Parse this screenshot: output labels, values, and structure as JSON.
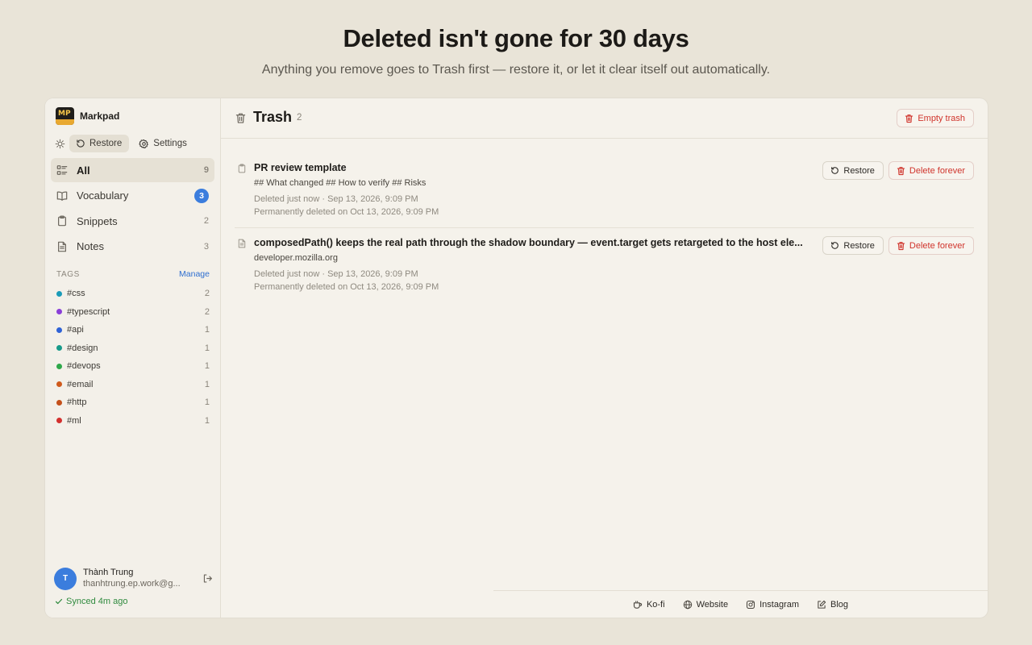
{
  "hero": {
    "title": "Deleted isn't gone for 30 days",
    "subtitle": "Anything you remove goes to Trash first — restore it, or let it clear itself out automatically."
  },
  "app": {
    "name": "Markpad",
    "logo_text": "MP"
  },
  "toolbar": {
    "restore_label": "Restore",
    "settings_label": "Settings"
  },
  "nav": {
    "items": [
      {
        "label": "All",
        "count": "9",
        "icon": "list-icon"
      },
      {
        "label": "Vocabulary",
        "count": "3",
        "icon": "book-icon"
      },
      {
        "label": "Snippets",
        "count": "2",
        "icon": "clipboard-icon"
      },
      {
        "label": "Notes",
        "count": "3",
        "icon": "note-icon"
      }
    ]
  },
  "tags": {
    "heading": "TAGS",
    "manage_label": "Manage",
    "items": [
      {
        "label": "#css",
        "count": "2",
        "color": "#1a9bb8"
      },
      {
        "label": "#typescript",
        "count": "2",
        "color": "#8a3fd8"
      },
      {
        "label": "#api",
        "count": "1",
        "color": "#2f62d6"
      },
      {
        "label": "#design",
        "count": "1",
        "color": "#179a8a"
      },
      {
        "label": "#devops",
        "count": "1",
        "color": "#2ea84a"
      },
      {
        "label": "#email",
        "count": "1",
        "color": "#cf5a1c"
      },
      {
        "label": "#http",
        "count": "1",
        "color": "#c4501b"
      },
      {
        "label": "#ml",
        "count": "1",
        "color": "#d3302e"
      }
    ]
  },
  "user": {
    "initial": "T",
    "name": "Thành Trung",
    "email": "thanhtrung.ep.work@g...",
    "sync_status": "Synced 4m ago"
  },
  "main": {
    "title": "Trash",
    "count": "2",
    "empty_label": "Empty trash",
    "rows": [
      {
        "title": "PR review template",
        "subtitle": "## What changed ## How to verify ## Risks",
        "deleted": "Deleted just now · Sep 13, 2026, 9:09 PM",
        "permanent": "Permanently deleted on Oct 13, 2026, 9:09 PM",
        "restore_label": "Restore",
        "delete_label": "Delete forever"
      },
      {
        "title": "composedPath() keeps the real path through the shadow boundary — event.target gets retargeted to the host ele...",
        "subtitle": "developer.mozilla.org",
        "deleted": "Deleted just now · Sep 13, 2026, 9:09 PM",
        "permanent": "Permanently deleted on Oct 13, 2026, 9:09 PM",
        "restore_label": "Restore",
        "delete_label": "Delete forever"
      }
    ]
  },
  "footer": {
    "links": [
      "Ko-fi",
      "Website",
      "Instagram",
      "Blog"
    ]
  },
  "colors": {
    "accent": "#3b7ddd",
    "danger": "#d0342c",
    "success": "#2f8a3e",
    "background": "#e9e4d8"
  }
}
